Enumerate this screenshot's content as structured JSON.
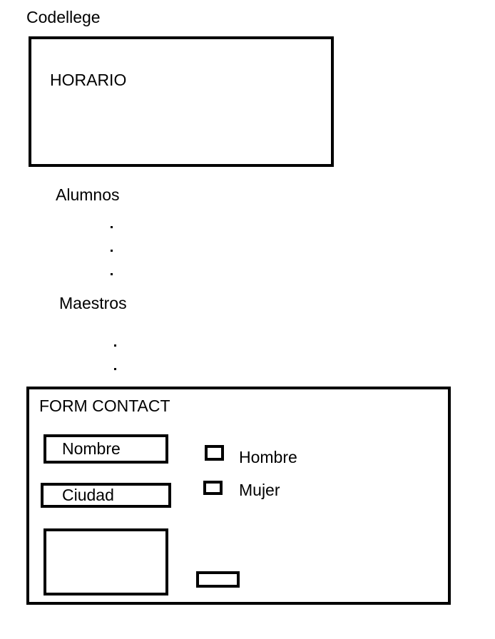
{
  "site": {
    "title": "Codellege"
  },
  "horario": {
    "label": "HORARIO"
  },
  "alumnos": {
    "label": "Alumnos"
  },
  "maestros": {
    "label": "Maestros"
  },
  "form": {
    "title": "FORM CONTACT",
    "nombre_placeholder": "Nombre",
    "ciudad_placeholder": "Ciudad",
    "hombre_label": "Hombre",
    "mujer_label": "Mujer"
  }
}
